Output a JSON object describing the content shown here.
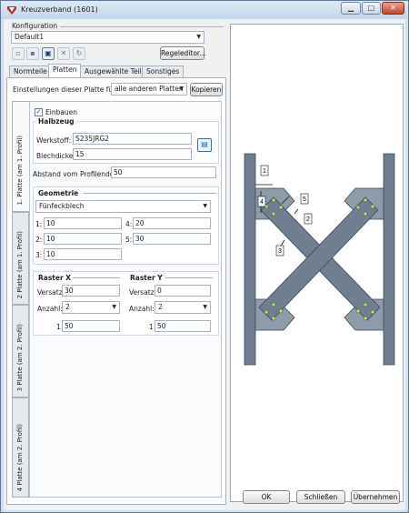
{
  "window": {
    "title": "Kreuzverband (1601)",
    "min": "▁",
    "max": "□",
    "close": "✕"
  },
  "konfig": {
    "label": "Konfiguration",
    "value": "Default1",
    "regeleditor": "Regeleditor..."
  },
  "tabs": [
    "Normteile",
    "Platten",
    "Ausgewählte Teile",
    "Sonstiges"
  ],
  "settings": {
    "label": "Einstellungen dieser Platte für",
    "value": "alle anderen Platten",
    "copy": "Kopieren"
  },
  "vtabs": [
    "1. Platte (am 1. Profil)",
    "2 Platte (am 1. Profil)",
    "3 Platte (am 2. Profil)",
    "4 Platte (am 2. Profil)"
  ],
  "plate": {
    "einbauen": "Einbauen",
    "checkmark": "✓",
    "halbzeug": "Halbzeug",
    "werkstoff_label": "Werkstoff:",
    "werkstoff": "S235JRG2",
    "blechdicke_label": "Blechdicke:",
    "blechdicke": "15",
    "abstand_label": "Abstand vom Profilende:",
    "abstand": "50",
    "geometrie": "Geometrie",
    "form": "Fünfeckblech",
    "dims": [
      {
        "label": "1:",
        "value": "10"
      },
      {
        "label": "4:",
        "value": "20"
      },
      {
        "label": "2:",
        "value": "10"
      },
      {
        "label": "5:",
        "value": "30"
      },
      {
        "label": "3:",
        "value": "10"
      }
    ]
  },
  "raster_x": {
    "title": "Raster X",
    "versatz_label": "Versatz:",
    "versatz": "30",
    "anzahl_label": "Anzahl:",
    "anzahl": "2",
    "row_label": "1",
    "row_value": "50"
  },
  "raster_y": {
    "title": "Raster Y",
    "versatz_label": "Versatz:",
    "versatz": "0",
    "anzahl_label": "Anzahl:",
    "anzahl": "2",
    "row_label": "1",
    "row_value": "50"
  },
  "preview_labels": [
    "1",
    "2",
    "3",
    "4",
    "5"
  ],
  "buttons": {
    "ok": "OK",
    "close": "Schließen",
    "apply": "Übernehmen"
  }
}
